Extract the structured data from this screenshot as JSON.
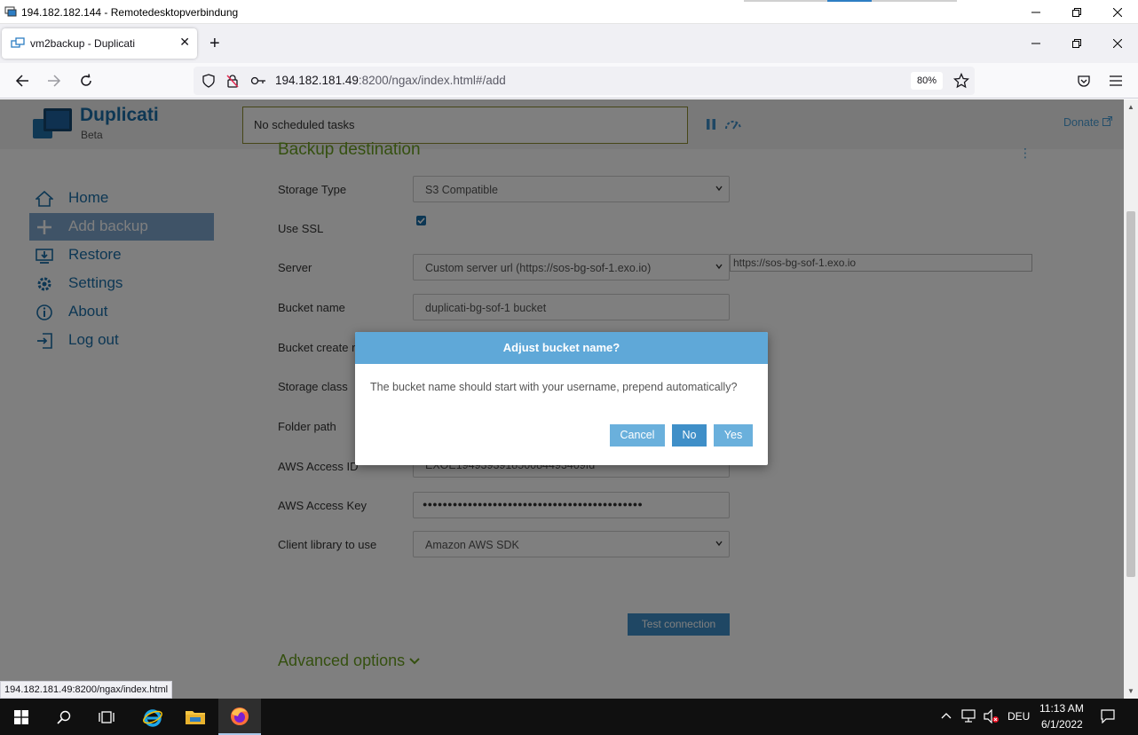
{
  "rdp": {
    "title": "194.182.182.144 - Remotedesktopverbindung"
  },
  "browser": {
    "tab_title": "vm2backup - Duplicati",
    "url_host": "194.182.181.49",
    "url_path": ":8200/ngax/index.html#/add",
    "zoom": "80%",
    "status_url": "194.182.181.49:8200/ngax/index.html"
  },
  "app": {
    "name": "Duplicati",
    "subtitle": "Beta",
    "scheduled": "No scheduled tasks",
    "donate": "Donate",
    "section_title": "Backup destination",
    "advanced_options": "Advanced options",
    "test_connection": "Test connection"
  },
  "sidebar": {
    "items": [
      {
        "label": "Home",
        "icon": "home-icon"
      },
      {
        "label": "Add backup",
        "icon": "plus-icon",
        "active": true
      },
      {
        "label": "Restore",
        "icon": "restore-icon"
      },
      {
        "label": "Settings",
        "icon": "gear-icon"
      },
      {
        "label": "About",
        "icon": "info-icon"
      },
      {
        "label": "Log out",
        "icon": "logout-icon"
      }
    ]
  },
  "form": {
    "storage_type": {
      "label": "Storage Type",
      "value": "S3 Compatible"
    },
    "use_ssl": {
      "label": "Use SSL",
      "checked": true
    },
    "server": {
      "label": "Server",
      "value": "Custom server url (https://sos-bg-sof-1.exo.io)",
      "custom_url": "https://sos-bg-sof-1.exo.io"
    },
    "bucket_name": {
      "label": "Bucket name",
      "value": "duplicati-bg-sof-1 bucket"
    },
    "bucket_create_region": {
      "label": "Bucket create r"
    },
    "storage_class": {
      "label": "Storage class"
    },
    "folder_path": {
      "label": "Folder path"
    },
    "aws_access_id": {
      "label": "AWS Access ID",
      "value": "EXOE194939391850084493409fd"
    },
    "aws_access_key": {
      "label": "AWS Access Key",
      "value": "●●●●●●●●●●●●●●●●●●●●●●●●●●●●●●●●●●●●●●●●●●●●"
    },
    "client_library": {
      "label": "Client library to use",
      "value": "Amazon AWS SDK"
    }
  },
  "modal": {
    "title": "Adjust bucket name?",
    "message": "The bucket name should start with your username, prepend automatically?",
    "cancel": "Cancel",
    "no": "No",
    "yes": "Yes"
  },
  "taskbar": {
    "language": "DEU",
    "time": "11:13 AM",
    "date": "6/1/2022"
  },
  "colors": {
    "accent": "#1a6ea8",
    "section_green": "#6aa020",
    "modal_header": "#5fa8d8"
  }
}
